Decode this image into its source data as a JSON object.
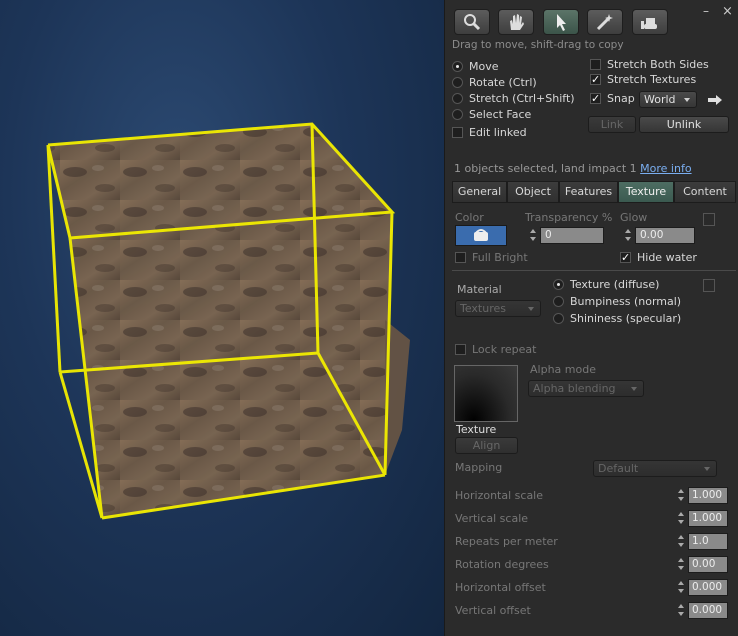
{
  "toolbar": {
    "tools": [
      {
        "name": "focus-tool",
        "icon": "magnifier-icon"
      },
      {
        "name": "move-tool",
        "icon": "hand-icon"
      },
      {
        "name": "edit-tool",
        "icon": "arrow-cursor-icon"
      },
      {
        "name": "create-tool",
        "icon": "wand-icon"
      },
      {
        "name": "land-tool",
        "icon": "bulldozer-icon"
      }
    ],
    "active_tool": 2,
    "hint": "Drag to move, shift-drag to copy",
    "minimize_label": "–",
    "close_label": "×"
  },
  "modes": {
    "move": "Move",
    "rotate": "Rotate (Ctrl)",
    "stretch": "Stretch (Ctrl+Shift)",
    "select_face": "Select Face",
    "edit_linked": "Edit linked"
  },
  "options": {
    "stretch_both_sides": "Stretch Both Sides",
    "stretch_textures": "Stretch Textures",
    "snap": "Snap",
    "snap_mode": "World",
    "check_mark": "✓"
  },
  "link_buttons": {
    "link": "Link",
    "unlink": "Unlink"
  },
  "selection": {
    "summary": "1 objects selected, land impact 1",
    "more_info": "More info"
  },
  "tabs": [
    "General",
    "Object",
    "Features",
    "Texture",
    "Content"
  ],
  "active_tab": "Texture",
  "texture_panel": {
    "color_label": "Color",
    "transparency_label": "Transparency %",
    "transparency_value": "0",
    "glow_label": "Glow",
    "glow_value": "0.00",
    "full_bright": "Full Bright",
    "hide_water": "Hide water",
    "material_label": "Material",
    "material_value": "Textures",
    "texture_diffuse": "Texture (diffuse)",
    "bumpiness": "Bumpiness (normal)",
    "shininess": "Shininess (specular)",
    "lock_repeat": "Lock repeat",
    "alpha_mode_label": "Alpha mode",
    "alpha_mode_value": "Alpha blending",
    "texture_label": "Texture",
    "align_button": "Align",
    "mapping_label": "Mapping",
    "mapping_value": "Default",
    "rows": [
      {
        "label": "Horizontal scale",
        "value": "1.000"
      },
      {
        "label": "Vertical scale",
        "value": "1.000"
      },
      {
        "label": "Repeats per meter",
        "value": "1.0"
      },
      {
        "label": "Rotation degrees",
        "value": "0.00"
      },
      {
        "label": "Horizontal offset",
        "value": "0.000"
      },
      {
        "label": "Vertical offset",
        "value": "0.000"
      }
    ]
  },
  "colors": {
    "selection_outline": "#f2ee00",
    "active_tab": "#4d6d62",
    "link": "#7aaef0"
  }
}
